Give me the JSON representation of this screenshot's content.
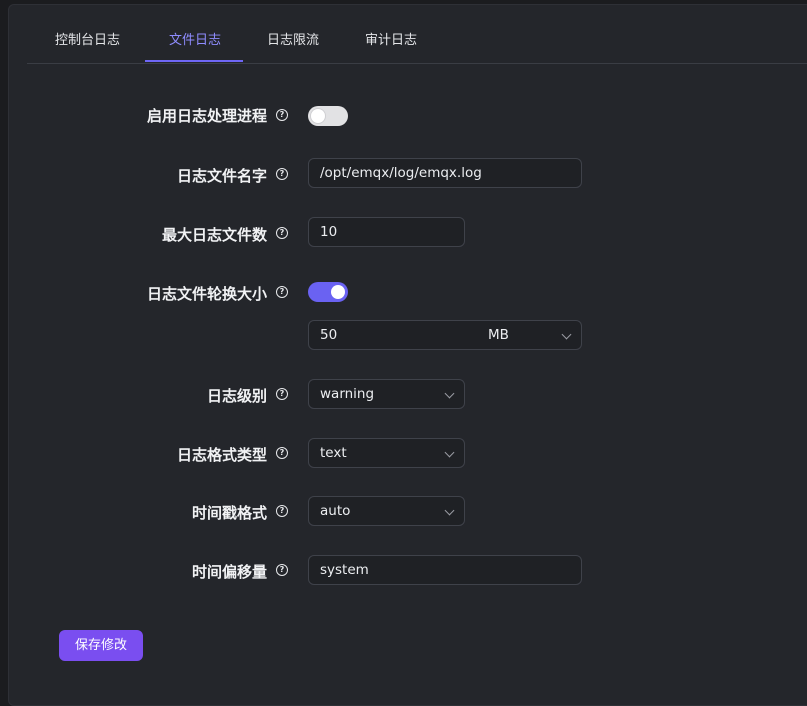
{
  "tabs": [
    {
      "label": "控制台日志"
    },
    {
      "label": "文件日志"
    },
    {
      "label": "日志限流"
    },
    {
      "label": "审计日志"
    }
  ],
  "active_tab": "文件日志",
  "form": {
    "enable_handler": {
      "label": "启用日志处理进程",
      "enabled": false
    },
    "file_name": {
      "label": "日志文件名字",
      "value": "/opt/emqx/log/emqx.log"
    },
    "max_files": {
      "label": "最大日志文件数",
      "value": "10"
    },
    "rotation_size": {
      "label": "日志文件轮换大小",
      "enabled": true,
      "value": "50",
      "unit": "MB"
    },
    "level": {
      "label": "日志级别",
      "value": "warning"
    },
    "formatter": {
      "label": "日志格式类型",
      "value": "text"
    },
    "timestamp_format": {
      "label": "时间戳格式",
      "value": "auto"
    },
    "time_offset": {
      "label": "时间偏移量",
      "value": "system"
    }
  },
  "help_glyph": "?",
  "save_button": "保存修改",
  "colors": {
    "accent": "#6a62f2",
    "active_tab_text": "#8f8cff",
    "save_button": "#7a4ef0"
  }
}
